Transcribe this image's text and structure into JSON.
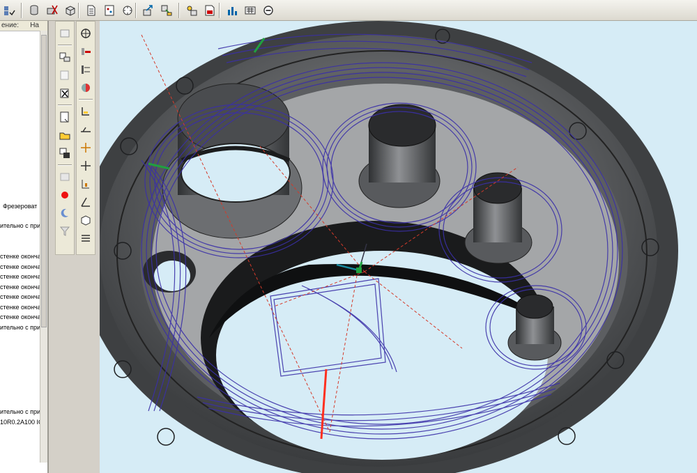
{
  "toolbar": {
    "icons": [
      "grid-check-icon",
      "cylinder-icon",
      "cut-tool-icon",
      "cube-icon",
      "document-icon",
      "pattern-icon",
      "fit-icon",
      "export-icon",
      "import-icon",
      "operation-icon",
      "report-icon",
      "bar-chart-icon",
      "calculator-icon",
      "minus-circle-icon"
    ]
  },
  "left_panel": {
    "header_left": "ение:",
    "header_right": "На",
    "lines": [
      {
        "text": "Фрезероват",
        "offset": 2
      },
      {
        "text": "ительно с при",
        "offset": 0
      },
      {
        "text": "стенке оконча",
        "offset": 0
      },
      {
        "text": "стенке оконча",
        "offset": 0
      },
      {
        "text": "стенке оконча",
        "offset": 0
      },
      {
        "text": "стенке оконча",
        "offset": 0
      },
      {
        "text": "стенке оконча",
        "offset": 0
      },
      {
        "text": "стенке оконча",
        "offset": 0
      },
      {
        "text": "стенке оконча",
        "offset": 0
      },
      {
        "text": "ительно с при",
        "offset": 0
      },
      {
        "text": "ительно с при",
        "offset": 0
      },
      {
        "text": "10R0.2A100 IC",
        "offset": 0
      }
    ]
  },
  "colors": {
    "toolpath": "#3a2fa8",
    "background": "#d6ecf6",
    "metal_dark": "#4d4f52",
    "metal_light": "#a7a9ab"
  }
}
